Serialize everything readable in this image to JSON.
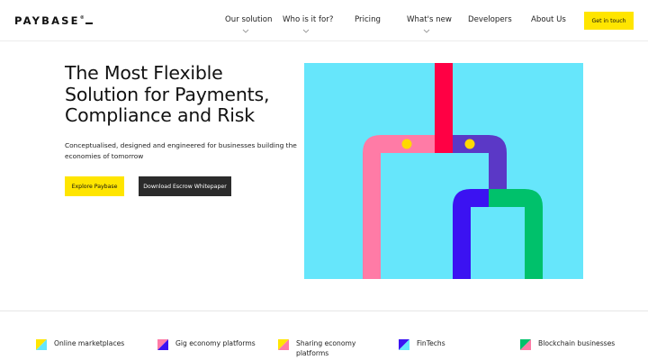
{
  "header": {
    "logo": "PAYBASE",
    "logo_mark": "®",
    "nav": [
      {
        "label": "Our solution",
        "has_dropdown": true
      },
      {
        "label": "Who is it for?",
        "has_dropdown": true
      },
      {
        "label": "Pricing",
        "has_dropdown": false
      },
      {
        "label": "What's new",
        "has_dropdown": true
      },
      {
        "label": "Developers",
        "has_dropdown": false
      },
      {
        "label": "About Us",
        "has_dropdown": false
      }
    ],
    "cta_label": "Get in touch"
  },
  "hero": {
    "title": "The Most Flexible Solution for Payments, Compliance and Risk",
    "subtitle": "Conceptualised, designed and engineered for businesses building the economies of tomorrow",
    "primary_button": "Explore Paybase",
    "secondary_button": "Download Escrow Whitepaper"
  },
  "categories": [
    {
      "label": "Online marketplaces",
      "icon": "marketplace-icon"
    },
    {
      "label": "Gig economy platforms",
      "icon": "gig-economy-icon"
    },
    {
      "label": "Sharing economy platforms",
      "icon": "sharing-economy-icon"
    },
    {
      "label": "FinTechs",
      "icon": "fintech-icon"
    },
    {
      "label": "Blockchain businesses",
      "icon": "blockchain-icon"
    }
  ],
  "colors": {
    "accent_yellow": "#ffe500",
    "dark_button": "#2b2b2b",
    "art_background": "#66e6fb",
    "art_red": "#ff0044",
    "art_pink": "#ff7ba6",
    "art_purple": "#5b38c6",
    "art_blue": "#3b12f2",
    "art_green": "#00c16b",
    "art_dot": "#ffd900"
  }
}
